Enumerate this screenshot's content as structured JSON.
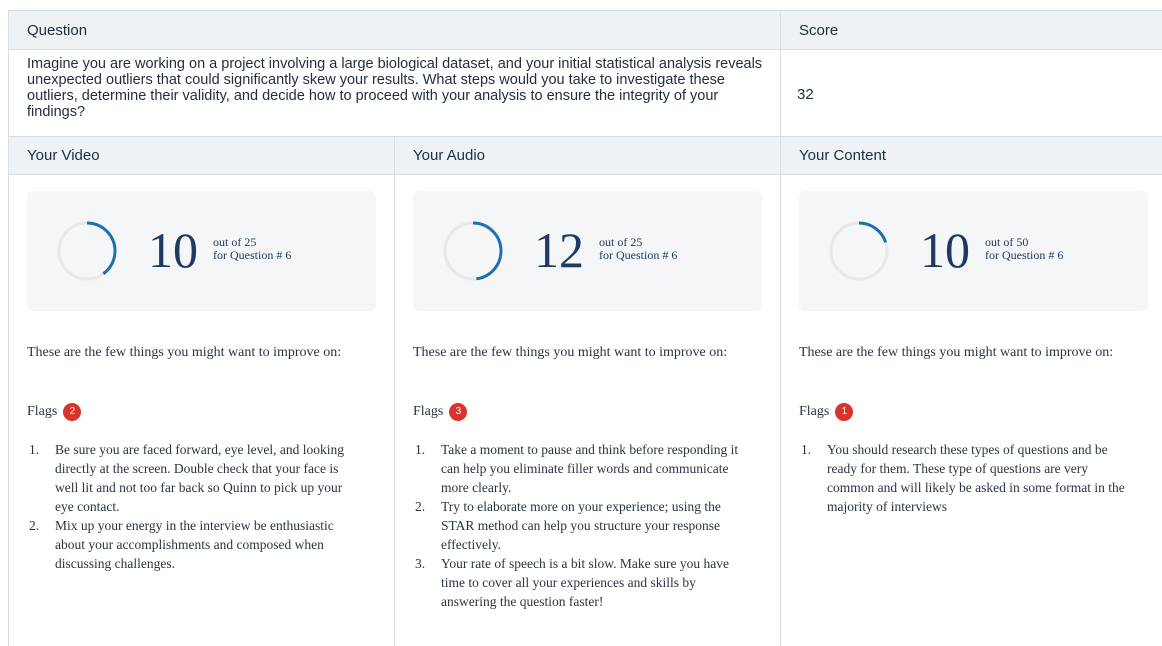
{
  "table": {
    "question_header": "Question",
    "score_header": "Score",
    "question_text": "Imagine you are working on a project involving a large biological dataset, and your initial statistical analysis reveals unexpected outliers that could significantly skew your results. What steps would you take to investigate these outliers, determine their validity, and decide how to proceed with your analysis to ensure the integrity of your findings?",
    "score_value": "32",
    "video_header": "Your Video",
    "audio_header": "Your Audio",
    "content_header": "Your Content"
  },
  "colors": {
    "ring_arc": "#1f6fb2",
    "ring_track": "#e6e8ea",
    "flag_badge": "#d9342b",
    "number": "#1e3a64"
  },
  "video": {
    "score": "10",
    "out_of": "out of 25",
    "question_ref": "for Question #  6",
    "fraction": 0.4,
    "improve_text": "These are the few things you might want to improve on:",
    "flags_label": "Flags",
    "flags_count": "2",
    "items": [
      "Be sure you are faced forward, eye level, and looking directly at the screen. Double check that your face is well lit and not too far back so Quinn to pick up your eye contact.",
      "Mix up your energy in the interview be enthusiastic about your accomplishments and composed when discussing challenges."
    ]
  },
  "audio": {
    "score": "12",
    "out_of": "out of 25",
    "question_ref": "for Question #  6",
    "fraction": 0.48,
    "improve_text": "These are the few things you might want to improve on:",
    "flags_label": "Flags",
    "flags_count": "3",
    "items": [
      "Take a moment to pause and think before responding it can help you eliminate filler words and communicate more clearly.",
      "Try to elaborate more on your experience; using the STAR method can help you structure your response effectively.",
      "Your rate of speech is a bit slow. Make sure you have time to cover all your experiences and skills by answering the question faster!"
    ]
  },
  "content": {
    "score": "10",
    "out_of": "out of 50",
    "question_ref": "for Question #  6",
    "fraction": 0.2,
    "improve_text": "These are the few things you might want to improve on:",
    "flags_label": "Flags",
    "flags_count": "1",
    "items": [
      "You should research these types of questions and be ready for them. These type of questions are very common and will likely be asked in some format in the majority of interviews"
    ]
  }
}
